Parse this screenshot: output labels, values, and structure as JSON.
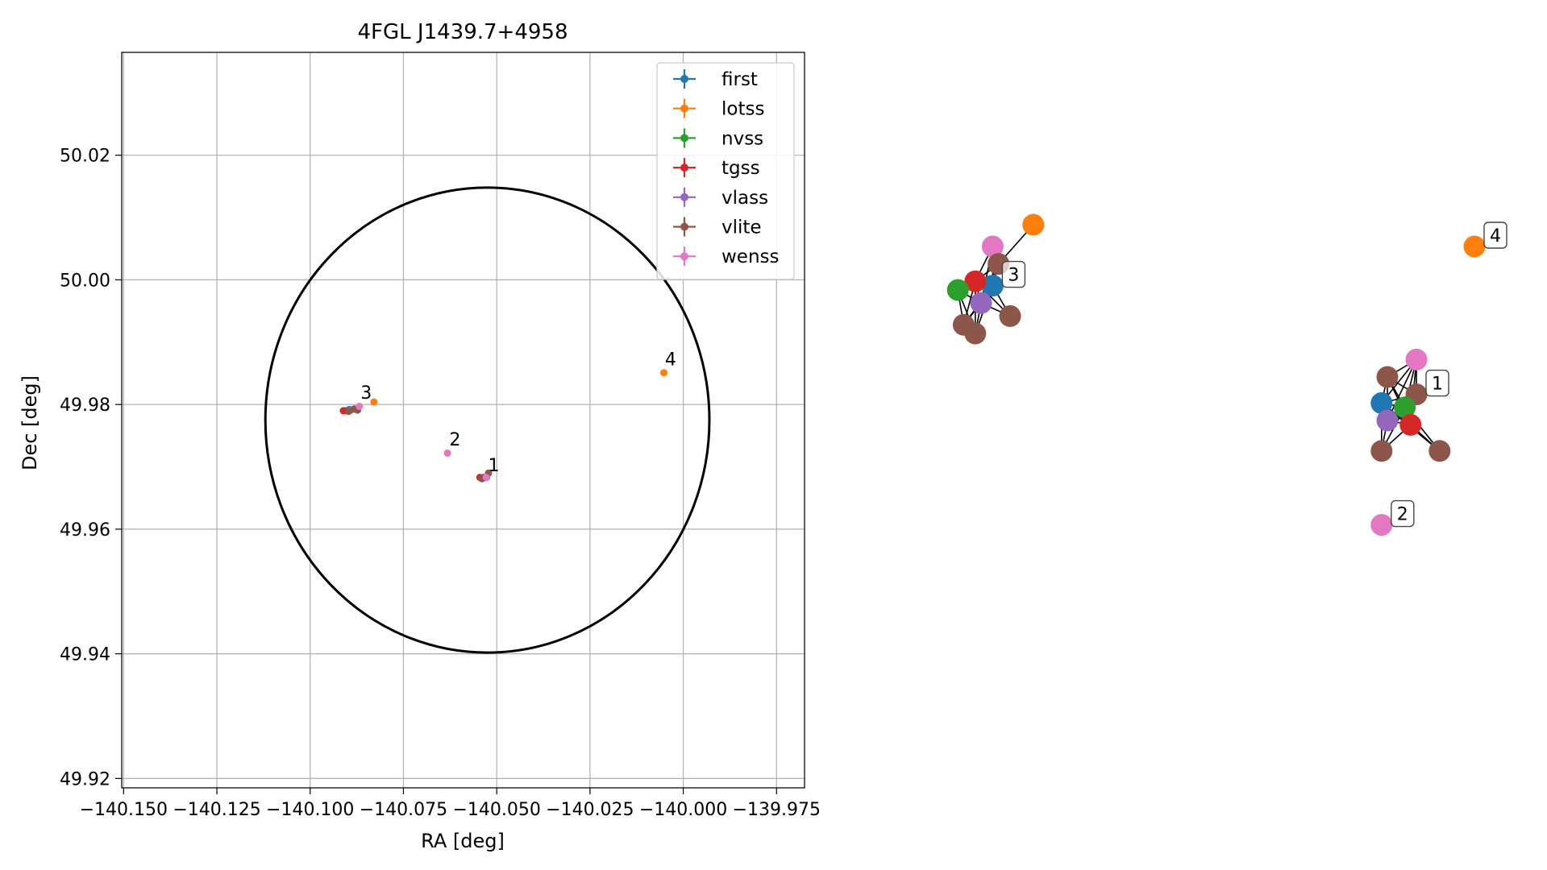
{
  "chart_data": [
    {
      "type": "scatter",
      "title": "4FGL J1439.7+4958",
      "xlabel": "RA [deg]",
      "ylabel": "Dec [deg]",
      "xlim": [
        -140.1505,
        -139.9675
      ],
      "ylim": [
        49.9185,
        50.0365
      ],
      "xticks": [
        -140.15,
        -140.125,
        -140.1,
        -140.075,
        -140.05,
        -140.025,
        -140.0,
        -139.975
      ],
      "xtick_labels": [
        "−140.150",
        "−140.125",
        "−140.100",
        "−140.075",
        "−140.050",
        "−140.025",
        "−140.000",
        "−139.975"
      ],
      "yticks": [
        49.92,
        49.94,
        49.96,
        49.98,
        50.0,
        50.02
      ],
      "ytick_labels": [
        "49.92",
        "49.94",
        "49.96",
        "49.98",
        "50.00",
        "50.02"
      ],
      "grid": true,
      "legend": "top-right",
      "circle": {
        "ra": -140.0525,
        "dec": 49.9775,
        "r_ra": 0.0595,
        "r_dec": 0.0373
      },
      "series": [
        {
          "name": "first",
          "color": "#1f77b4",
          "x": [
            -140.0535,
            -140.0895
          ],
          "y": [
            49.9683,
            49.9792
          ]
        },
        {
          "name": "lotss",
          "color": "#ff7f0e",
          "x": [
            -140.0829,
            -140.0052
          ],
          "y": [
            49.9804,
            49.9851
          ]
        },
        {
          "name": "nvss",
          "color": "#2ca02c",
          "x": [
            -140.0527,
            -140.0906
          ],
          "y": [
            49.9683,
            49.979
          ]
        },
        {
          "name": "tgss",
          "color": "#d62728",
          "x": [
            -140.0545,
            -140.0911
          ],
          "y": [
            49.9683,
            49.979
          ]
        },
        {
          "name": "vlass",
          "color": "#9467bd",
          "x": [
            -140.0534,
            -140.0891
          ],
          "y": [
            49.9682,
            49.9791
          ]
        },
        {
          "name": "vlite",
          "color": "#8c564b",
          "x": [
            -140.0522,
            -140.054,
            -140.0897,
            -140.0882,
            -140.0873
          ],
          "y": [
            49.969,
            49.9681,
            49.9789,
            49.9793,
            49.9791
          ]
        },
        {
          "name": "wenss",
          "color": "#e377c2",
          "x": [
            -140.0528,
            -140.0632,
            -140.0868
          ],
          "y": [
            49.9683,
            49.9722,
            49.9797
          ]
        }
      ],
      "annotations": [
        {
          "text": "1",
          "x": -140.0523,
          "y": 49.9693
        },
        {
          "text": "2",
          "x": -140.0627,
          "y": 49.9734
        },
        {
          "text": "3",
          "x": -140.0865,
          "y": 49.9809
        },
        {
          "text": "4",
          "x": -140.0049,
          "y": 49.9863
        }
      ]
    },
    {
      "type": "network",
      "edge_color": "#000000",
      "node_labels": [
        "1",
        "2",
        "3",
        "4"
      ],
      "nodes": [
        {
          "id": "g3-wenss",
          "color": "#e377c2",
          "x": 0.12,
          "y": 0.85
        },
        {
          "id": "g3-lotss",
          "color": "#ff7f0e",
          "x": 0.19,
          "y": 0.9
        },
        {
          "id": "g3-vlite1",
          "color": "#8c564b",
          "x": 0.13,
          "y": 0.81
        },
        {
          "id": "g3-first",
          "color": "#1f77b4",
          "x": 0.12,
          "y": 0.76
        },
        {
          "id": "g3-tgss",
          "color": "#d62728",
          "x": 0.09,
          "y": 0.77
        },
        {
          "id": "g3-nvss",
          "color": "#2ca02c",
          "x": 0.06,
          "y": 0.75
        },
        {
          "id": "g3-vlass",
          "color": "#9467bd",
          "x": 0.1,
          "y": 0.72
        },
        {
          "id": "g3-vlite2",
          "color": "#8c564b",
          "x": 0.15,
          "y": 0.69
        },
        {
          "id": "g3-vlite3",
          "color": "#8c564b",
          "x": 0.07,
          "y": 0.67
        },
        {
          "id": "g3-vlite4",
          "color": "#8c564b",
          "x": 0.09,
          "y": 0.65
        },
        {
          "id": "g4-lotss",
          "color": "#ff7f0e",
          "x": 0.95,
          "y": 0.85
        },
        {
          "id": "g1-wenss",
          "color": "#e377c2",
          "x": 0.85,
          "y": 0.59
        },
        {
          "id": "g1-vlite1",
          "color": "#8c564b",
          "x": 0.8,
          "y": 0.55
        },
        {
          "id": "g1-vlite2",
          "color": "#8c564b",
          "x": 0.85,
          "y": 0.51
        },
        {
          "id": "g1-first",
          "color": "#1f77b4",
          "x": 0.79,
          "y": 0.49
        },
        {
          "id": "g1-nvss",
          "color": "#2ca02c",
          "x": 0.83,
          "y": 0.48
        },
        {
          "id": "g1-vlass",
          "color": "#9467bd",
          "x": 0.8,
          "y": 0.45
        },
        {
          "id": "g1-tgss",
          "color": "#d62728",
          "x": 0.84,
          "y": 0.44
        },
        {
          "id": "g1-vlite3",
          "color": "#8c564b",
          "x": 0.79,
          "y": 0.38
        },
        {
          "id": "g1-vlite4",
          "color": "#8c564b",
          "x": 0.89,
          "y": 0.38
        },
        {
          "id": "g2-wenss",
          "color": "#e377c2",
          "x": 0.79,
          "y": 0.21
        }
      ],
      "edges": [
        [
          "g3-wenss",
          "g3-vlite1"
        ],
        [
          "g3-wenss",
          "g3-first"
        ],
        [
          "g3-wenss",
          "g3-tgss"
        ],
        [
          "g3-wenss",
          "g3-vlass"
        ],
        [
          "g3-lotss",
          "g3-vlite1"
        ],
        [
          "g3-vlite1",
          "g3-first"
        ],
        [
          "g3-vlite1",
          "g3-tgss"
        ],
        [
          "g3-vlite1",
          "g3-vlass"
        ],
        [
          "g3-first",
          "g3-tgss"
        ],
        [
          "g3-first",
          "g3-nvss"
        ],
        [
          "g3-first",
          "g3-vlass"
        ],
        [
          "g3-first",
          "g3-vlite2"
        ],
        [
          "g3-first",
          "g3-vlite3"
        ],
        [
          "g3-first",
          "g3-vlite4"
        ],
        [
          "g3-tgss",
          "g3-nvss"
        ],
        [
          "g3-tgss",
          "g3-vlass"
        ],
        [
          "g3-tgss",
          "g3-vlite2"
        ],
        [
          "g3-tgss",
          "g3-vlite3"
        ],
        [
          "g3-tgss",
          "g3-vlite4"
        ],
        [
          "g3-nvss",
          "g3-vlass"
        ],
        [
          "g3-nvss",
          "g3-vlite3"
        ],
        [
          "g3-nvss",
          "g3-vlite4"
        ],
        [
          "g3-vlass",
          "g3-vlite2"
        ],
        [
          "g3-vlass",
          "g3-vlite3"
        ],
        [
          "g3-vlass",
          "g3-vlite4"
        ],
        [
          "g1-wenss",
          "g1-vlite1"
        ],
        [
          "g1-wenss",
          "g1-vlite2"
        ],
        [
          "g1-wenss",
          "g1-nvss"
        ],
        [
          "g1-wenss",
          "g1-tgss"
        ],
        [
          "g1-wenss",
          "g1-vlass"
        ],
        [
          "g1-wenss",
          "g1-first"
        ],
        [
          "g1-vlite1",
          "g1-vlite2"
        ],
        [
          "g1-vlite1",
          "g1-first"
        ],
        [
          "g1-vlite1",
          "g1-nvss"
        ],
        [
          "g1-vlite1",
          "g1-vlass"
        ],
        [
          "g1-vlite1",
          "g1-tgss"
        ],
        [
          "g1-vlite2",
          "g1-first"
        ],
        [
          "g1-vlite2",
          "g1-nvss"
        ],
        [
          "g1-vlite2",
          "g1-vlass"
        ],
        [
          "g1-vlite2",
          "g1-tgss"
        ],
        [
          "g1-first",
          "g1-nvss"
        ],
        [
          "g1-first",
          "g1-vlass"
        ],
        [
          "g1-first",
          "g1-tgss"
        ],
        [
          "g1-first",
          "g1-vlite3"
        ],
        [
          "g1-first",
          "g1-vlite4"
        ],
        [
          "g1-nvss",
          "g1-vlass"
        ],
        [
          "g1-nvss",
          "g1-tgss"
        ],
        [
          "g1-nvss",
          "g1-vlite3"
        ],
        [
          "g1-nvss",
          "g1-vlite4"
        ],
        [
          "g1-vlass",
          "g1-tgss"
        ],
        [
          "g1-vlass",
          "g1-vlite3"
        ],
        [
          "g1-tgss",
          "g1-vlite3"
        ],
        [
          "g1-tgss",
          "g1-vlite4"
        ]
      ],
      "labels": [
        {
          "text": "1",
          "node": "g1-vlite2"
        },
        {
          "text": "2",
          "node": "g2-wenss"
        },
        {
          "text": "3",
          "node": "g3-first"
        },
        {
          "text": "4",
          "node": "g4-lotss"
        }
      ]
    }
  ]
}
